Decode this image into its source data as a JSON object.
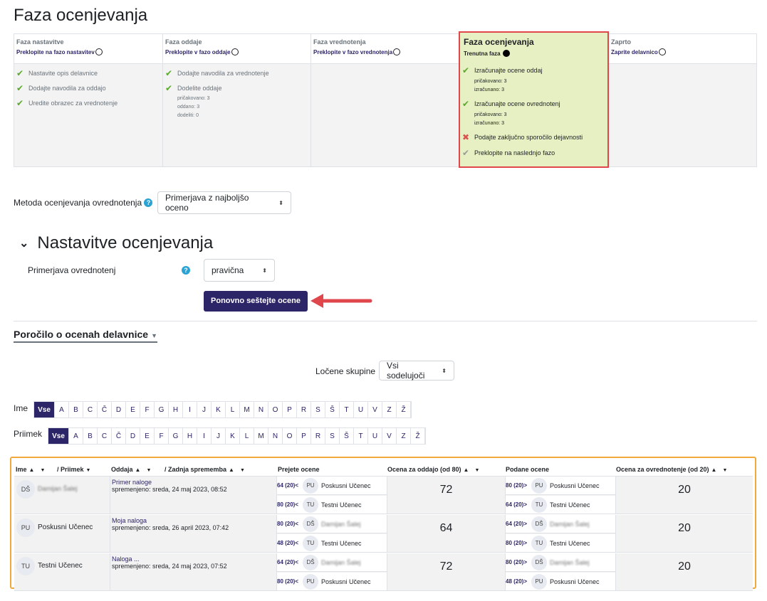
{
  "page_title": "Faza ocenjevanja",
  "phases": [
    {
      "title": "Faza nastavitve",
      "link": "Preklopite na fazo nastavitev",
      "tasks": [
        {
          "icon": "check-icon",
          "text": "Nastavite opis delavnice"
        },
        {
          "icon": "check-icon",
          "text": "Dodajte navodila za oddajo"
        },
        {
          "icon": "check-icon",
          "text": "Uredite obrazec za vrednotenje"
        }
      ]
    },
    {
      "title": "Faza oddaje",
      "link": "Preklopite v fazo oddaje",
      "tasks": [
        {
          "icon": "check-icon",
          "text": "Dodajte navodila za vrednotenje"
        },
        {
          "icon": "check-icon",
          "text": "Dodelite oddaje"
        }
      ],
      "stats": [
        "pričakovano: 3",
        "oddano: 3",
        "dodeliti: 0"
      ]
    },
    {
      "title": "Faza vrednotenja",
      "link": "Preklopite v fazo vrednotenja",
      "tasks": []
    },
    {
      "title": "Faza ocenjevanja",
      "link": "Trenutna faza",
      "tasks": [
        {
          "icon": "check-icon",
          "text": "Izračunajte ocene oddaj",
          "sub": [
            "pričakovano: 3",
            "izračunano: 3"
          ]
        },
        {
          "icon": "check-icon",
          "text": "Izračunajte ocene ovrednotenj",
          "sub": [
            "pričakovano: 3",
            "izračunano: 3"
          ]
        },
        {
          "icon": "cross-icon",
          "text": "Podajte zaključno sporočilo dejavnosti"
        },
        {
          "icon": "pending-check-icon",
          "text": "Preklopite na naslednjo fazo"
        }
      ]
    },
    {
      "title": "Zaprto",
      "link": "Zaprite delavnico",
      "tasks": []
    }
  ],
  "evaluation_method": {
    "label": "Metoda ocenjevanja ovrednotenja",
    "value": "Primerjava z najboljšo oceno"
  },
  "grading_settings": {
    "title": "Nastavitve ocenjevanja",
    "comparison_label": "Primerjava ovrednotenj",
    "comparison_value": "pravična",
    "recalc_button": "Ponovno seštejte ocene"
  },
  "report": {
    "title": "Poročilo o ocenah delavnice",
    "groups_label": "Ločene skupine",
    "groups_value": "Vsi sodelujoči",
    "first_name_label": "Ime",
    "last_name_label": "Priimek",
    "all_label": "Vse",
    "letters": [
      "A",
      "B",
      "C",
      "Č",
      "D",
      "E",
      "F",
      "G",
      "H",
      "I",
      "J",
      "K",
      "L",
      "M",
      "N",
      "O",
      "P",
      "R",
      "S",
      "Š",
      "T",
      "U",
      "V",
      "Z",
      "Ž"
    ]
  },
  "table": {
    "headers": {
      "name": "Ime",
      "surname": "/ Priimek",
      "submission": "Oddaja",
      "last_change": "/ Zadnja sprememba",
      "received": "Prejete ocene",
      "grade_sub": "Ocena za oddajo (od 80)",
      "given": "Podane ocene",
      "grade_assess": "Ocena za ovrednotenje (od 20)"
    },
    "rows": [
      {
        "avatar": "DŠ",
        "name": "Damijan Šalej",
        "sub_title": "Primer naloge",
        "sub_modified": "spremenjeno: sreda, 24 maj 2023, 08:52",
        "received": [
          {
            "grade": "64 (20)<",
            "avatar": "PU",
            "name": "Poskusni Učenec"
          },
          {
            "grade": "80 (20)<",
            "avatar": "TU",
            "name": "Testni Učenec"
          }
        ],
        "grade_sub": "72",
        "given": [
          {
            "grade": "80 (20)>",
            "avatar": "PU",
            "name": "Poskusni Učenec"
          },
          {
            "grade": "64 (20)>",
            "avatar": "TU",
            "name": "Testni Učenec"
          }
        ],
        "grade_assess": "20"
      },
      {
        "avatar": "PU",
        "name": "Poskusni Učenec",
        "sub_title": "Moja naloga",
        "sub_modified": "spremenjeno: sreda, 26 april 2023, 07:42",
        "received": [
          {
            "grade": "80 (20)<",
            "avatar": "DŠ",
            "name": "Damijan Šalej"
          },
          {
            "grade": "48 (20)<",
            "avatar": "TU",
            "name": "Testni Učenec"
          }
        ],
        "grade_sub": "64",
        "given": [
          {
            "grade": "64 (20)>",
            "avatar": "DŠ",
            "name": "Damijan Šalej"
          },
          {
            "grade": "80 (20)>",
            "avatar": "TU",
            "name": "Testni Učenec"
          }
        ],
        "grade_assess": "20"
      },
      {
        "avatar": "TU",
        "name": "Testni Učenec",
        "sub_title": "Naloga ...",
        "sub_modified": "spremenjeno: sreda, 24 maj 2023, 07:52",
        "received": [
          {
            "grade": "64 (20)<",
            "avatar": "DŠ",
            "name": "Damijan Šalej"
          },
          {
            "grade": "80 (20)<",
            "avatar": "PU",
            "name": "Poskusni Učenec"
          }
        ],
        "grade_sub": "72",
        "given": [
          {
            "grade": "80 (20)>",
            "avatar": "DŠ",
            "name": "Damijan Šalej"
          },
          {
            "grade": "48 (20)>",
            "avatar": "PU",
            "name": "Poskusni Učenec"
          }
        ],
        "grade_assess": "20"
      }
    ]
  },
  "colors": {
    "primary": "#2c2568",
    "check": "#5aa92a",
    "current_bg": "#e6f0c2",
    "highlight_red": "#e0474c",
    "table_outline": "#f0a93a"
  }
}
